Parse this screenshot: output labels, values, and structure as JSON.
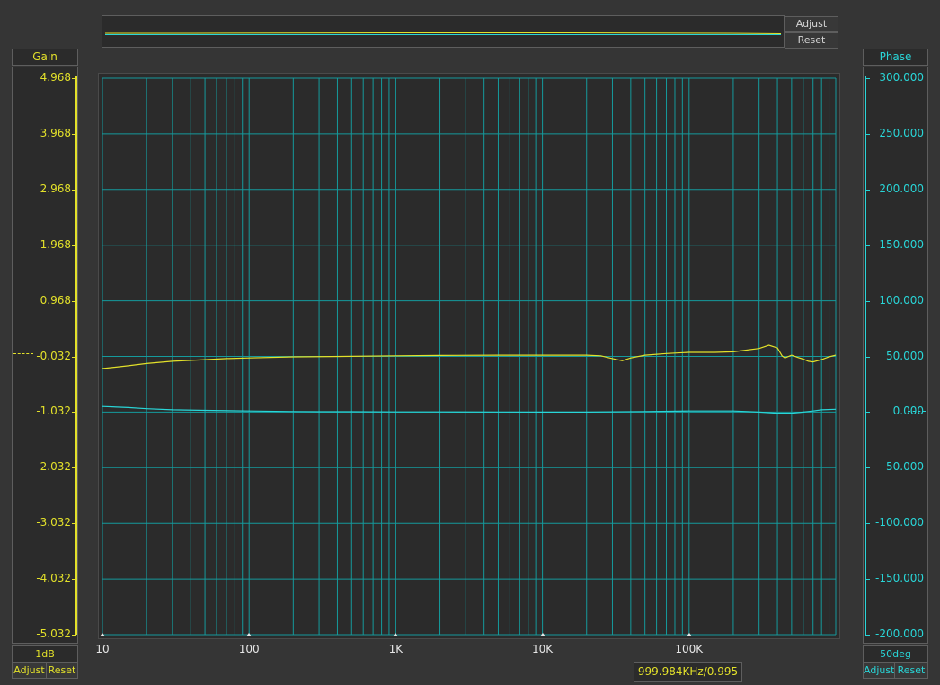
{
  "colors": {
    "gain": "#e3e12a",
    "phase": "#29d6d8",
    "grid": "#159a9c",
    "plot_bg": "#2b2b2b"
  },
  "overview": {
    "adjust_label": "Adjust",
    "reset_label": "Reset"
  },
  "gain_panel": {
    "title": "Gain",
    "scale": "1dB",
    "adjust_label": "Adjust",
    "reset_label": "Reset"
  },
  "phase_panel": {
    "title": "Phase",
    "scale": "50deg",
    "adjust_label": "Adjust",
    "reset_label": "Reset"
  },
  "cursor_readout": "999.984KHz/0.995",
  "chart_data": {
    "type": "line",
    "x_scale": "log",
    "xlim": [
      10,
      1000000
    ],
    "x_ticks": [
      10,
      100,
      1000,
      10000,
      100000
    ],
    "x_tick_labels": [
      "10",
      "100",
      "1K",
      "10K",
      "100K"
    ],
    "gain_axis": {
      "ylim": [
        -5.032,
        4.968
      ],
      "ticks": [
        4.968,
        3.968,
        2.968,
        1.968,
        0.968,
        -0.032,
        -1.032,
        -2.032,
        -3.032,
        -4.032,
        -5.032
      ],
      "tick_labels": [
        "4.968",
        "3.968",
        "2.968",
        "1.968",
        "0.968",
        "-0.032",
        "-1.032",
        "-2.032",
        "-3.032",
        "-4.032",
        "-5.032"
      ]
    },
    "phase_axis": {
      "ylim": [
        -200,
        300
      ],
      "ticks": [
        300,
        250,
        200,
        150,
        100,
        50,
        0,
        -50,
        -100,
        -150,
        -200
      ],
      "tick_labels": [
        "300.000",
        "250.000",
        "200.000",
        "150.000",
        "100.000",
        "50.000",
        "0.000",
        "-50.000",
        "-100.000",
        "-150.000",
        "-200.000"
      ]
    },
    "grid": true,
    "series": [
      {
        "axis": "gain",
        "x": [
          10,
          15,
          20,
          30,
          50,
          70,
          100,
          200,
          500,
          1000,
          2000,
          5000,
          10000,
          20000,
          25000,
          30000,
          35000,
          40000,
          50000,
          70000,
          100000,
          150000,
          200000,
          300000,
          350000,
          400000,
          430000,
          450000,
          500000,
          550000,
          600000,
          650000,
          700000,
          800000,
          900000,
          1000000
        ],
        "y": [
          -0.25,
          -0.2,
          -0.16,
          -0.12,
          -0.09,
          -0.07,
          -0.06,
          -0.04,
          -0.03,
          -0.02,
          -0.015,
          -0.01,
          -0.01,
          -0.01,
          -0.02,
          -0.07,
          -0.11,
          -0.06,
          -0.01,
          0.02,
          0.04,
          0.04,
          0.05,
          0.11,
          0.17,
          0.12,
          -0.02,
          -0.06,
          -0.01,
          -0.05,
          -0.08,
          -0.12,
          -0.13,
          -0.09,
          -0.04,
          -0.01
        ]
      },
      {
        "axis": "phase",
        "x": [
          10,
          15,
          20,
          30,
          50,
          100,
          200,
          300,
          500,
          1000,
          2000,
          5000,
          10000,
          20000,
          50000,
          100000,
          200000,
          300000,
          400000,
          500000,
          600000,
          700000,
          800000,
          1000000
        ],
        "y": [
          5,
          4,
          3,
          2,
          1.5,
          1,
          0.5,
          0.3,
          0.3,
          0.2,
          0.2,
          0.1,
          0,
          0,
          0.5,
          1,
          1,
          0,
          -1,
          -1,
          0,
          1,
          2,
          2.5
        ]
      }
    ]
  }
}
